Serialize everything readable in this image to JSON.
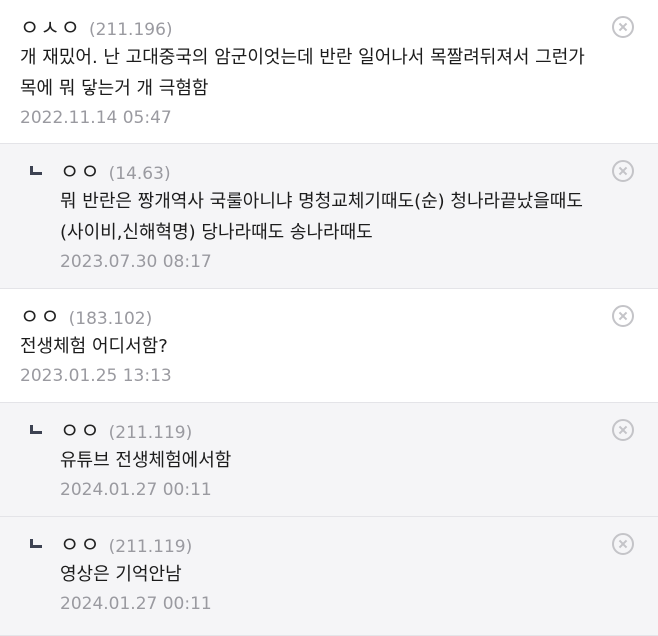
{
  "comments": [
    {
      "nick": "ㅇㅅㅇ",
      "ip": "(211.196)",
      "text_line1": "개 재밌어. 난 고대중국의 암군이엇는데 반란 일어나서 목짤려뒤져서 그런가",
      "text_line2": "목에 뭐 닿는거 개 극혐함",
      "date": "2022.11.14 05:47"
    },
    {
      "nick": "ㅇㅇ",
      "ip": "(14.63)",
      "text_line1": "뭐 반란은 짱개역사 국룰아니냐 명청교체기때도(순) 청나라끝났을때도",
      "text_line2": "(사이비,신해혁명) 당나라때도 송나라때도",
      "date": "2023.07.30 08:17"
    },
    {
      "nick": "ㅇㅇ",
      "ip": "(183.102)",
      "text_line1": "전생체험 어디서함?",
      "date": "2023.01.25 13:13"
    },
    {
      "nick": "ㅇㅇ",
      "ip": "(211.119)",
      "text_line1": "유튜브 전생체험에서함",
      "date": "2024.01.27 00:11"
    },
    {
      "nick": "ㅇㅇ",
      "ip": "(211.119)",
      "text_line1": "영상은 기억안남",
      "date": "2024.01.27 00:11"
    }
  ],
  "icons": {
    "delete": "circle-x-icon",
    "reply": "reply-arrow-icon"
  },
  "colors": {
    "reply_bg": "#f5f5f7",
    "meta_gray": "#9a9aa0",
    "divider": "#e4e4e8"
  }
}
